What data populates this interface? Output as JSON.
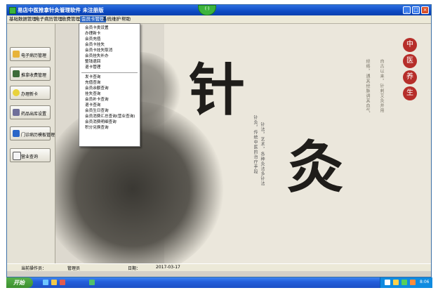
{
  "window": {
    "title": "易店中医推拿针灸管理软件 未注册版",
    "badge": "(·)",
    "controls": {
      "min": "_",
      "max": "□",
      "close": "×"
    }
  },
  "menubar": {
    "items": [
      "基础数据管理",
      "电子病历管理",
      "收费管理",
      "会员卡管理",
      "系统维护",
      "帮助"
    ],
    "active": "会员卡管理"
  },
  "sidebar": {
    "items": [
      "电子病历管理",
      "推拿收费管理",
      "办理新卡",
      "药品出库设置",
      "门诊病历模板管理",
      "营业查询"
    ]
  },
  "dropdown": {
    "group1": [
      "会员卡类设置",
      "办理新卡",
      "会员充值",
      "会员卡挂失",
      "会员卡挂失取消",
      "会员挂失补办",
      "整钱退回",
      "退卡管理"
    ],
    "group2": [
      "发卡查询",
      "充值查询",
      "会员余额查询",
      "挂失查询",
      "会员补卡查询",
      "退卡查询",
      "会员生日查询",
      "会员消费汇总查询(营业查询)",
      "会员消费明细查询",
      "积分兑换查询"
    ]
  },
  "background": {
    "char1": "针",
    "char2": "灸",
    "seals": [
      "中",
      "医",
      "养",
      "生"
    ],
    "poem": [
      "针法，艺术，各种灸法多针法",
      "针灸，传统中医的治疗手段",
      "经络，通其经脉调其血气",
      "自古以来，针刺艾灸并用"
    ]
  },
  "statusbar": {
    "operator_label": "当前操作员：",
    "operator_value": "管理员",
    "date_label": "日期：",
    "date_value": "2017-03-17"
  },
  "taskbar": {
    "start": "开始",
    "time": "8:06"
  },
  "colors": {
    "title_blue": "#0d4bc3",
    "menu_highlight": "#316ac5",
    "seal_red": "#b62e2a"
  }
}
